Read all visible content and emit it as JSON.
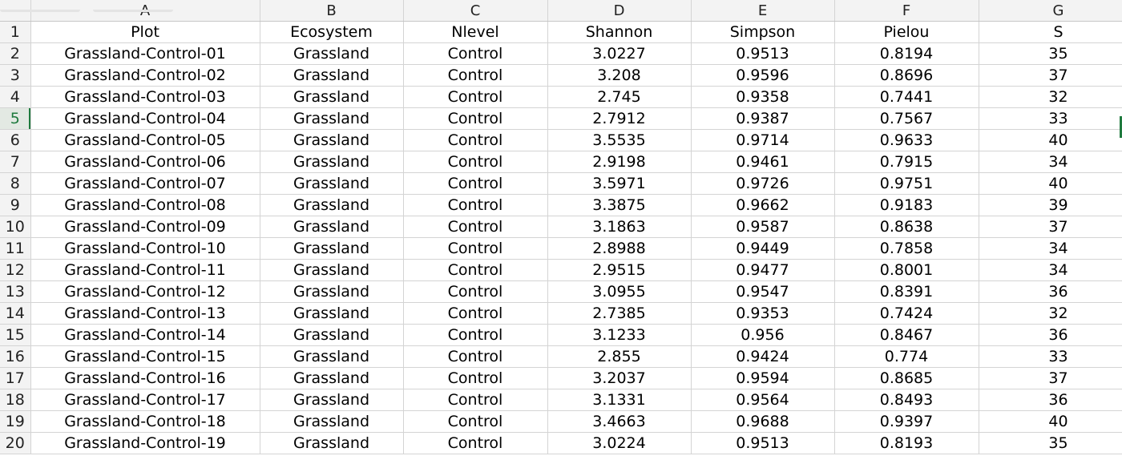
{
  "columns": [
    "A",
    "B",
    "C",
    "D",
    "E",
    "F",
    "G"
  ],
  "active_row": "5",
  "rows": [
    {
      "n": "1",
      "cells": [
        "Plot",
        "Ecosystem",
        "Nlevel",
        "Shannon",
        "Simpson",
        "Pielou",
        "S"
      ]
    },
    {
      "n": "2",
      "cells": [
        "Grassland-Control-01",
        "Grassland",
        "Control",
        "3.0227",
        "0.9513",
        "0.8194",
        "35"
      ]
    },
    {
      "n": "3",
      "cells": [
        "Grassland-Control-02",
        "Grassland",
        "Control",
        "3.208",
        "0.9596",
        "0.8696",
        "37"
      ]
    },
    {
      "n": "4",
      "cells": [
        "Grassland-Control-03",
        "Grassland",
        "Control",
        "2.745",
        "0.9358",
        "0.7441",
        "32"
      ]
    },
    {
      "n": "5",
      "cells": [
        "Grassland-Control-04",
        "Grassland",
        "Control",
        "2.7912",
        "0.9387",
        "0.7567",
        "33"
      ]
    },
    {
      "n": "6",
      "cells": [
        "Grassland-Control-05",
        "Grassland",
        "Control",
        "3.5535",
        "0.9714",
        "0.9633",
        "40"
      ]
    },
    {
      "n": "7",
      "cells": [
        "Grassland-Control-06",
        "Grassland",
        "Control",
        "2.9198",
        "0.9461",
        "0.7915",
        "34"
      ]
    },
    {
      "n": "8",
      "cells": [
        "Grassland-Control-07",
        "Grassland",
        "Control",
        "3.5971",
        "0.9726",
        "0.9751",
        "40"
      ]
    },
    {
      "n": "9",
      "cells": [
        "Grassland-Control-08",
        "Grassland",
        "Control",
        "3.3875",
        "0.9662",
        "0.9183",
        "39"
      ]
    },
    {
      "n": "10",
      "cells": [
        "Grassland-Control-09",
        "Grassland",
        "Control",
        "3.1863",
        "0.9587",
        "0.8638",
        "37"
      ]
    },
    {
      "n": "11",
      "cells": [
        "Grassland-Control-10",
        "Grassland",
        "Control",
        "2.8988",
        "0.9449",
        "0.7858",
        "34"
      ]
    },
    {
      "n": "12",
      "cells": [
        "Grassland-Control-11",
        "Grassland",
        "Control",
        "2.9515",
        "0.9477",
        "0.8001",
        "34"
      ]
    },
    {
      "n": "13",
      "cells": [
        "Grassland-Control-12",
        "Grassland",
        "Control",
        "3.0955",
        "0.9547",
        "0.8391",
        "36"
      ]
    },
    {
      "n": "14",
      "cells": [
        "Grassland-Control-13",
        "Grassland",
        "Control",
        "2.7385",
        "0.9353",
        "0.7424",
        "32"
      ]
    },
    {
      "n": "15",
      "cells": [
        "Grassland-Control-14",
        "Grassland",
        "Control",
        "3.1233",
        "0.956",
        "0.8467",
        "36"
      ]
    },
    {
      "n": "16",
      "cells": [
        "Grassland-Control-15",
        "Grassland",
        "Control",
        "2.855",
        "0.9424",
        "0.774",
        "33"
      ]
    },
    {
      "n": "17",
      "cells": [
        "Grassland-Control-16",
        "Grassland",
        "Control",
        "3.2037",
        "0.9594",
        "0.8685",
        "37"
      ]
    },
    {
      "n": "18",
      "cells": [
        "Grassland-Control-17",
        "Grassland",
        "Control",
        "3.1331",
        "0.9564",
        "0.8493",
        "36"
      ]
    },
    {
      "n": "19",
      "cells": [
        "Grassland-Control-18",
        "Grassland",
        "Control",
        "3.4663",
        "0.9688",
        "0.9397",
        "40"
      ]
    },
    {
      "n": "20",
      "cells": [
        "Grassland-Control-19",
        "Grassland",
        "Control",
        "3.0224",
        "0.9513",
        "0.8193",
        "35"
      ]
    }
  ]
}
